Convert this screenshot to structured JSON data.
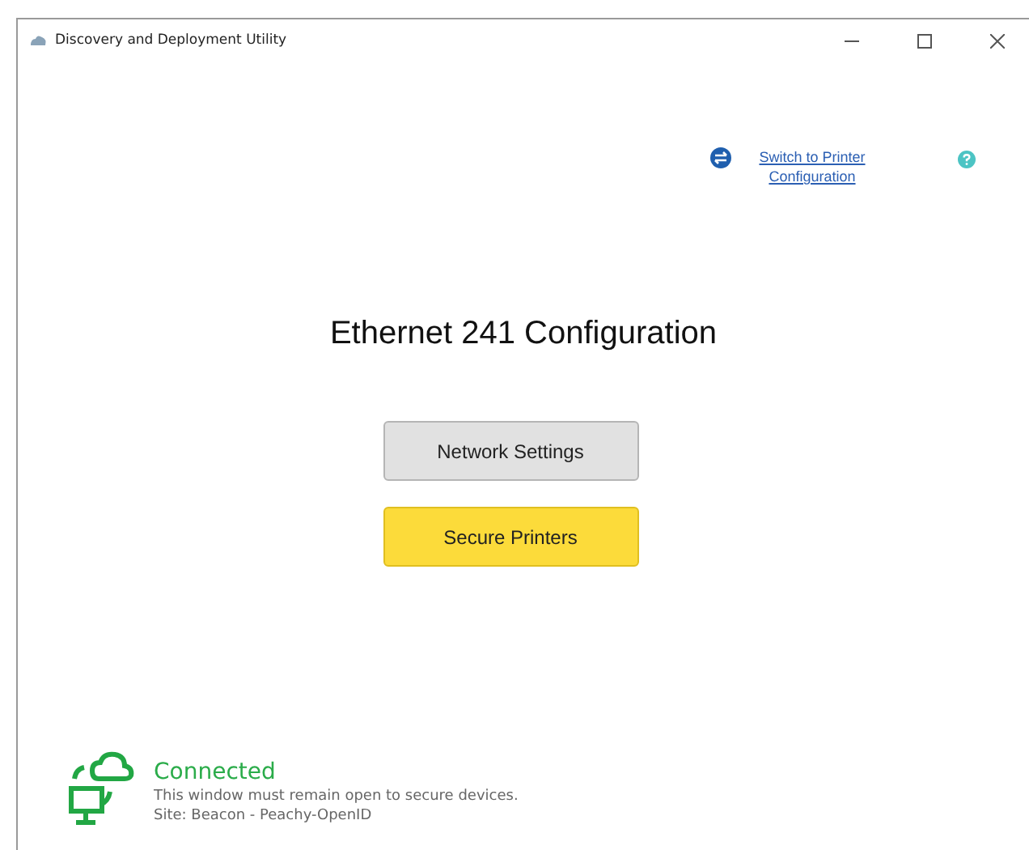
{
  "window": {
    "title": "Discovery and Deployment Utility"
  },
  "switch_link": "Switch to Printer Configuration",
  "heading": "Ethernet 241 Configuration",
  "buttons": [
    {
      "label": "Network Settings",
      "kind": "default"
    },
    {
      "label": "Secure Printers",
      "kind": "primary"
    }
  ],
  "status": {
    "title": "Connected",
    "message": "This window must remain open to secure devices.",
    "site": "Site: Beacon - Peachy-OpenID"
  }
}
